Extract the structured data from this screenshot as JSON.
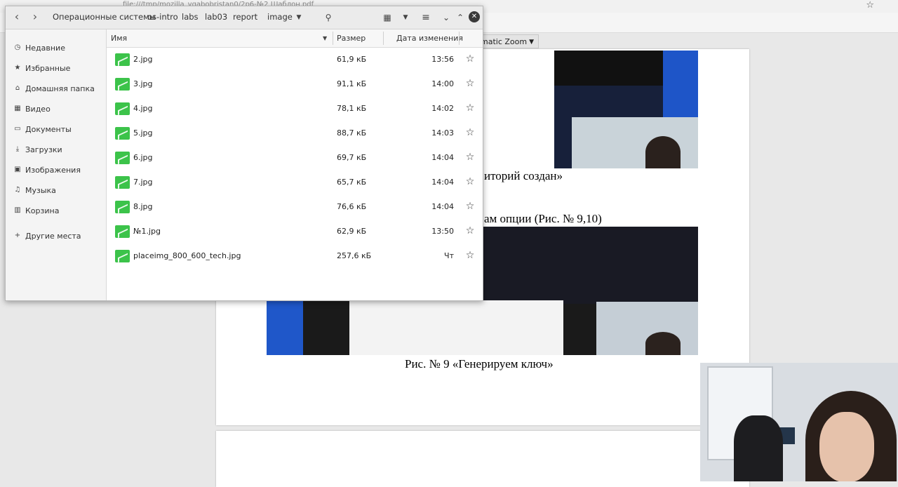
{
  "browser": {
    "url": "file:///tmp/mozilla_vgabobristan0/2p6-№2 Шаблон.pdf",
    "zoom_label": "matic Zoom"
  },
  "document": {
    "line1": "иторий создан»",
    "line2": "ам опции (Рис. № 9,10)",
    "caption": "Рис. № 9 «Генерируем ключ»"
  },
  "file_manager": {
    "breadcrumbs": [
      "Операционные системы",
      "os-intro",
      "labs",
      "lab03",
      "report",
      "image"
    ],
    "columns": {
      "name": "Имя",
      "size": "Размер",
      "modified": "Дата изменения"
    },
    "sidebar": [
      {
        "icon": "clock-icon",
        "label": "Недавние"
      },
      {
        "icon": "star-icon",
        "label": "Избранные"
      },
      {
        "icon": "home-icon",
        "label": "Домашняя папка"
      },
      {
        "icon": "video-icon",
        "label": "Видео"
      },
      {
        "icon": "document-icon",
        "label": "Документы"
      },
      {
        "icon": "download-icon",
        "label": "Загрузки"
      },
      {
        "icon": "image-icon",
        "label": "Изображения"
      },
      {
        "icon": "music-icon",
        "label": "Музыка"
      },
      {
        "icon": "trash-icon",
        "label": "Корзина"
      },
      {
        "icon": "plus-icon",
        "label": "Другие места"
      }
    ],
    "files": [
      {
        "name": "2.jpg",
        "size": "61,9 кБ",
        "modified": "13:56"
      },
      {
        "name": "3.jpg",
        "size": "91,1 кБ",
        "modified": "14:00"
      },
      {
        "name": "4.jpg",
        "size": "78,1 кБ",
        "modified": "14:02"
      },
      {
        "name": "5.jpg",
        "size": "88,7 кБ",
        "modified": "14:03"
      },
      {
        "name": "6.jpg",
        "size": "69,7 кБ",
        "modified": "14:04"
      },
      {
        "name": "7.jpg",
        "size": "65,7 кБ",
        "modified": "14:04"
      },
      {
        "name": "8.jpg",
        "size": "76,6 кБ",
        "modified": "14:04"
      },
      {
        "name": "№1.jpg",
        "size": "62,9 кБ",
        "modified": "13:50"
      },
      {
        "name": "placeimg_800_600_tech.jpg",
        "size": "257,6 кБ",
        "modified": "Чт"
      }
    ]
  }
}
